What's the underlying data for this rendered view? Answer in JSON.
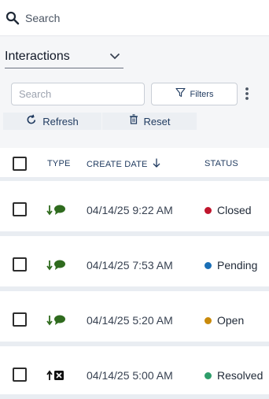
{
  "topbar": {
    "search_label": "Search"
  },
  "controls": {
    "view_select": "Interactions",
    "search_placeholder": "Search",
    "filters_label": "Filters",
    "refresh_label": "Refresh",
    "reset_label": "Reset"
  },
  "grid": {
    "columns": {
      "type": "TYPE",
      "create_date": "CREATE DATE",
      "status": "STATUS"
    },
    "sort": {
      "column": "create_date",
      "direction": "descending"
    },
    "rows": [
      {
        "type_icon": "inbound-chat-icon",
        "create_date": "04/14/25 9:22 AM",
        "status": "Closed",
        "status_color": "#c0162d"
      },
      {
        "type_icon": "inbound-chat-icon",
        "create_date": "04/14/25 7:53 AM",
        "status": "Pending",
        "status_color": "#1a6fb6"
      },
      {
        "type_icon": "inbound-chat-icon",
        "create_date": "04/14/25 5:20 AM",
        "status": "Open",
        "status_color": "#c98a0b"
      },
      {
        "type_icon": "outbound-x-icon",
        "create_date": "04/14/25 5:00 AM",
        "status": "Resolved",
        "status_color": "#2e9d6a"
      }
    ]
  },
  "colors": {
    "accent": "#1f3a5f",
    "chat_icon": "#2f6b1e",
    "row_separator": "#e9edf2",
    "panel_bg": "#f5f6f8"
  }
}
